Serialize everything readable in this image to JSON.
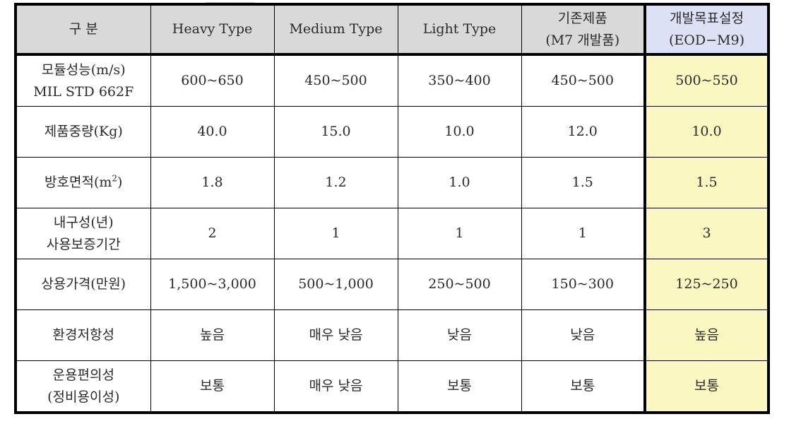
{
  "table": {
    "headers": [
      {
        "lines": [
          "구 분"
        ]
      },
      {
        "lines": [
          "Heavy  Type"
        ]
      },
      {
        "lines": [
          "Medium  Type"
        ]
      },
      {
        "lines": [
          "Light  Type"
        ]
      },
      {
        "lines": [
          "기존제품",
          "(M7  개발품)"
        ]
      },
      {
        "lines": [
          "개발목표설정",
          "(EOD−M9)"
        ]
      }
    ],
    "rows": [
      {
        "label": [
          "모듈성능(m/s)",
          "MIL  STD  662F"
        ],
        "values": [
          "600~650",
          "450~500",
          "350~400",
          "450~500",
          "500~550"
        ]
      },
      {
        "label": [
          "제품중량(Kg)"
        ],
        "values": [
          "40.0",
          "15.0",
          "10.0",
          "12.0",
          "10.0"
        ]
      },
      {
        "label": [
          "방호면적(m",
          "2",
          ")"
        ],
        "values": [
          "1.8",
          "1.2",
          "1.0",
          "1.5",
          "1.5"
        ]
      },
      {
        "label": [
          "내구성(년)",
          "사용보증기간"
        ],
        "values": [
          "2",
          "1",
          "1",
          "1",
          "3"
        ]
      },
      {
        "label": [
          "상용가격(만원)"
        ],
        "values": [
          "1,500~3,000",
          "500~1,000",
          "250~500",
          "150~300",
          "125~250"
        ]
      },
      {
        "label": [
          "환경저항성"
        ],
        "values": [
          "높음",
          "매우 낮음",
          "낮음",
          "낮음",
          "높음"
        ]
      },
      {
        "label": [
          "운용편의성",
          "(정비용이성)"
        ],
        "values": [
          "보통",
          "매우 낮음",
          "보통",
          "보통",
          "보통"
        ]
      }
    ]
  },
  "colors": {
    "header_bg": "#d9d9d9",
    "target_header_bg": "#dde1f5",
    "target_cell_bg": "#fbf7c0"
  }
}
